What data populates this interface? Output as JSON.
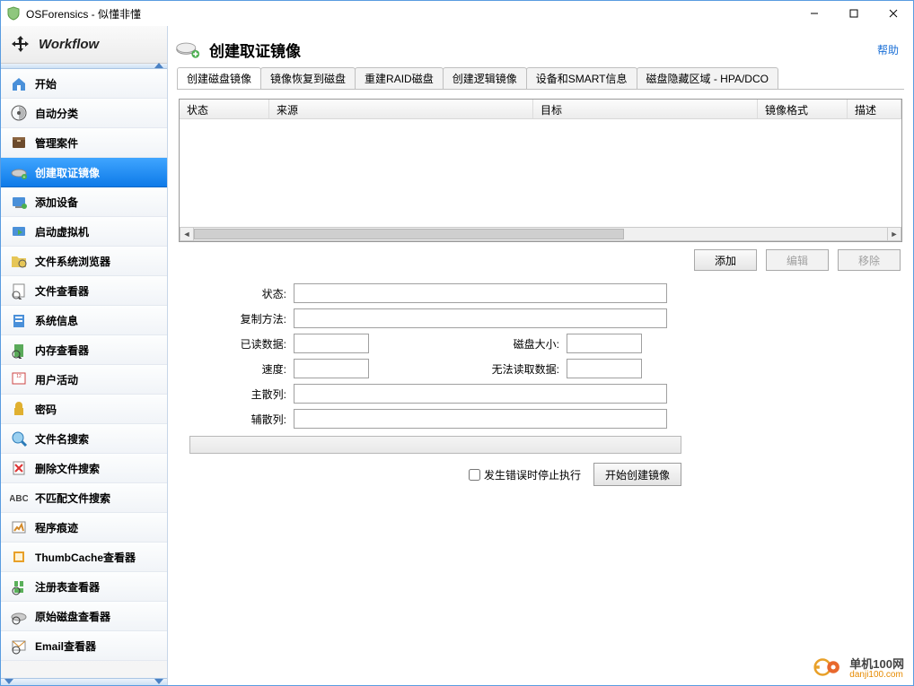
{
  "title": "OSForensics - 似懂非懂",
  "sidebar": {
    "title": "Workflow",
    "items": [
      {
        "label": "开始"
      },
      {
        "label": "自动分类"
      },
      {
        "label": "管理案件"
      },
      {
        "label": "创建取证镜像"
      },
      {
        "label": "添加设备"
      },
      {
        "label": "启动虚拟机"
      },
      {
        "label": "文件系统浏览器"
      },
      {
        "label": "文件查看器"
      },
      {
        "label": "系统信息"
      },
      {
        "label": "内存查看器"
      },
      {
        "label": "用户活动"
      },
      {
        "label": "密码"
      },
      {
        "label": "文件名搜索"
      },
      {
        "label": "删除文件搜索"
      },
      {
        "label": "不匹配文件搜索"
      },
      {
        "label": "程序痕迹"
      },
      {
        "label": "ThumbCache查看器"
      },
      {
        "label": "注册表查看器"
      },
      {
        "label": "原始磁盘查看器"
      },
      {
        "label": "Email查看器"
      }
    ],
    "active_index": 3
  },
  "page": {
    "heading": "创建取证镜像",
    "help": "帮助"
  },
  "tabs": {
    "items": [
      "创建磁盘镜像",
      "镜像恢复到磁盘",
      "重建RAID磁盘",
      "创建逻辑镜像",
      "设备和SMART信息",
      "磁盘隐藏区域 - HPA/DCO"
    ],
    "active_index": 0
  },
  "columns": [
    "状态",
    "来源",
    "目标",
    "镜像格式",
    "描述"
  ],
  "buttons": {
    "add": "添加",
    "edit": "编辑",
    "delete": "移除"
  },
  "form": {
    "status_label": "状态:",
    "copy_method_label": "复制方法:",
    "read_data_label": "已读数据:",
    "disk_size_label": "磁盘大小:",
    "speed_label": "速度:",
    "unreadable_label": "无法读取数据:",
    "primary_hash_label": "主散列:",
    "secondary_hash_label": "辅散列:"
  },
  "action": {
    "stop_on_error": "发生错误时停止执行",
    "start": "开始创建镜像"
  },
  "watermark": {
    "line1": "单机100网",
    "line2": "danji100.com"
  }
}
